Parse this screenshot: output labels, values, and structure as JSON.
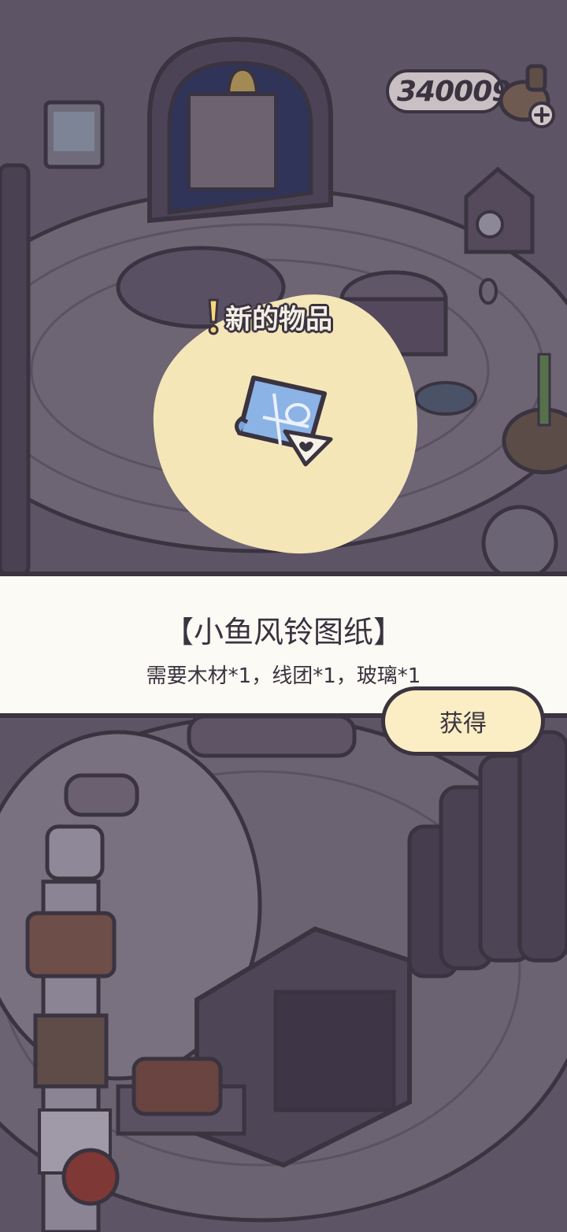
{
  "hud": {
    "currency_value": "340009",
    "currency_icon": "clover-pot-icon",
    "add_icon": "plus-icon"
  },
  "popup": {
    "new_item_label": "新的物品",
    "alert_icon": "exclamation-icon",
    "item_icon": "blueprint-scroll-icon"
  },
  "banner": {
    "item_name": "【小鱼风铃图纸】",
    "requirement": "需要木材*1，线团*1，玻璃*1",
    "obtain_label": "获得"
  },
  "colors": {
    "outline": "#3a3340",
    "dim_background": "#5e5566",
    "highlight_blob": "#f5e6b8",
    "button_fill": "#fbeec4",
    "banner_fill": "#fcfaf4"
  }
}
